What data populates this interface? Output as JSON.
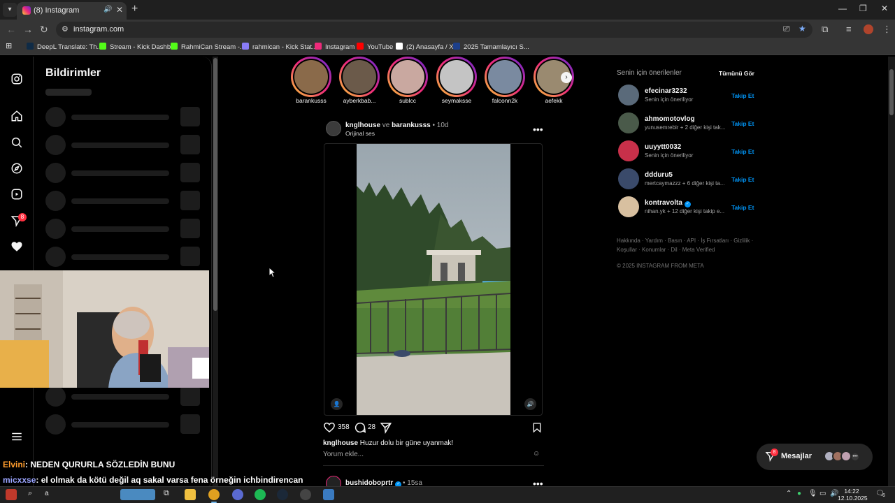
{
  "browser": {
    "tab_title": "(8) Instagram",
    "url": "instagram.com",
    "bookmarks": [
      {
        "label": "DeepL Translate: Th...",
        "color": "#0f2b46"
      },
      {
        "label": "Stream - Kick Dashb...",
        "color": "#53fc18"
      },
      {
        "label": "RahmiCan Stream -...",
        "color": "#53fc18"
      },
      {
        "label": "rahmican - Kick Stat...",
        "color": "#8a7cf7"
      },
      {
        "label": "Instagram",
        "color": "#ee2a7b"
      },
      {
        "label": "YouTube",
        "color": "#ff0000"
      },
      {
        "label": "(2) Anasayfa / X",
        "color": "#ffffff"
      },
      {
        "label": "2025 Tamamlayıcı S...",
        "color": "#1d3f8a"
      }
    ]
  },
  "sidebar": {
    "notif_badge": "8",
    "icons": [
      "instagram-logo-icon",
      "home-icon",
      "search-icon",
      "explore-icon",
      "reels-icon",
      "messenger-icon",
      "heart-icon",
      "menu-icon"
    ]
  },
  "notifications": {
    "title": "Bildirimler"
  },
  "stories": [
    {
      "name": "barankusss",
      "color": "#8a6a4a"
    },
    {
      "name": "ayberkbab...",
      "color": "#6b5a4a"
    },
    {
      "name": "sublcc",
      "color": "#c9a8a0"
    },
    {
      "name": "seymaksse",
      "color": "#a8a8a8"
    },
    {
      "name": "falconn2k",
      "color": "#7a8aa0"
    },
    {
      "name": "aefekk",
      "color": "#9a8a70"
    }
  ],
  "post": {
    "author": "knglhouse",
    "connector": "ve",
    "coauthor": "barankusss",
    "time": "• 10d",
    "audio": "Orijinal ses",
    "likes": "358",
    "comments": "28",
    "caption_user": "knglhouse",
    "caption_text": "Huzur dolu bir güne uyanmak!",
    "comment_placeholder": "Yorum ekle..."
  },
  "next_post": {
    "author": "bushidoboprtr",
    "time": "• 15sa"
  },
  "suggestions": {
    "header": "Senin için önerilenler",
    "see_all": "Tümünü Gör",
    "follow_label": "Takip Et",
    "items": [
      {
        "user": "efecinar3232",
        "sub": "Senin için öneriliyor",
        "verified": false,
        "color": "#5a6a7a"
      },
      {
        "user": "ahmomotovlog",
        "sub": "yunusemrebir + 2 diğer kişi tak...",
        "verified": false,
        "color": "#4a5a4a"
      },
      {
        "user": "uuyytt0032",
        "sub": "Senin için öneriliyor",
        "verified": false,
        "color": "#c8304a"
      },
      {
        "user": "ddduru5",
        "sub": "mertcaymazzz + 6 diğer kişi ta...",
        "verified": false,
        "color": "#3a4a6a"
      },
      {
        "user": "kontravolta",
        "sub": "nihan.yk + 12 diğer kişi takip e...",
        "verified": true,
        "color": "#d8c0a0"
      }
    ],
    "footer_line1": "Hakkında · Yardım · Basın · API · İş Fırsatları · Gizlilik ·",
    "footer_line2": "Koşullar · Konumlar · Dil · Meta Verified",
    "copyright": "© 2025 INSTAGRAM FROM META"
  },
  "messages": {
    "label": "Mesajlar",
    "badge": "8"
  },
  "chat": [
    {
      "user": "Elvini",
      "text": ": NEDEN QURURLA SÖZLEDİN BUNU"
    },
    {
      "user": "micxxse",
      "text": ": el olmak da kötü değil aq sakal varsa fena örneğin ichbindirencan"
    }
  ],
  "taskbar": {
    "time": "14:22",
    "date": "12.10.2025",
    "search_hint": "a",
    "notif_count": "6"
  }
}
